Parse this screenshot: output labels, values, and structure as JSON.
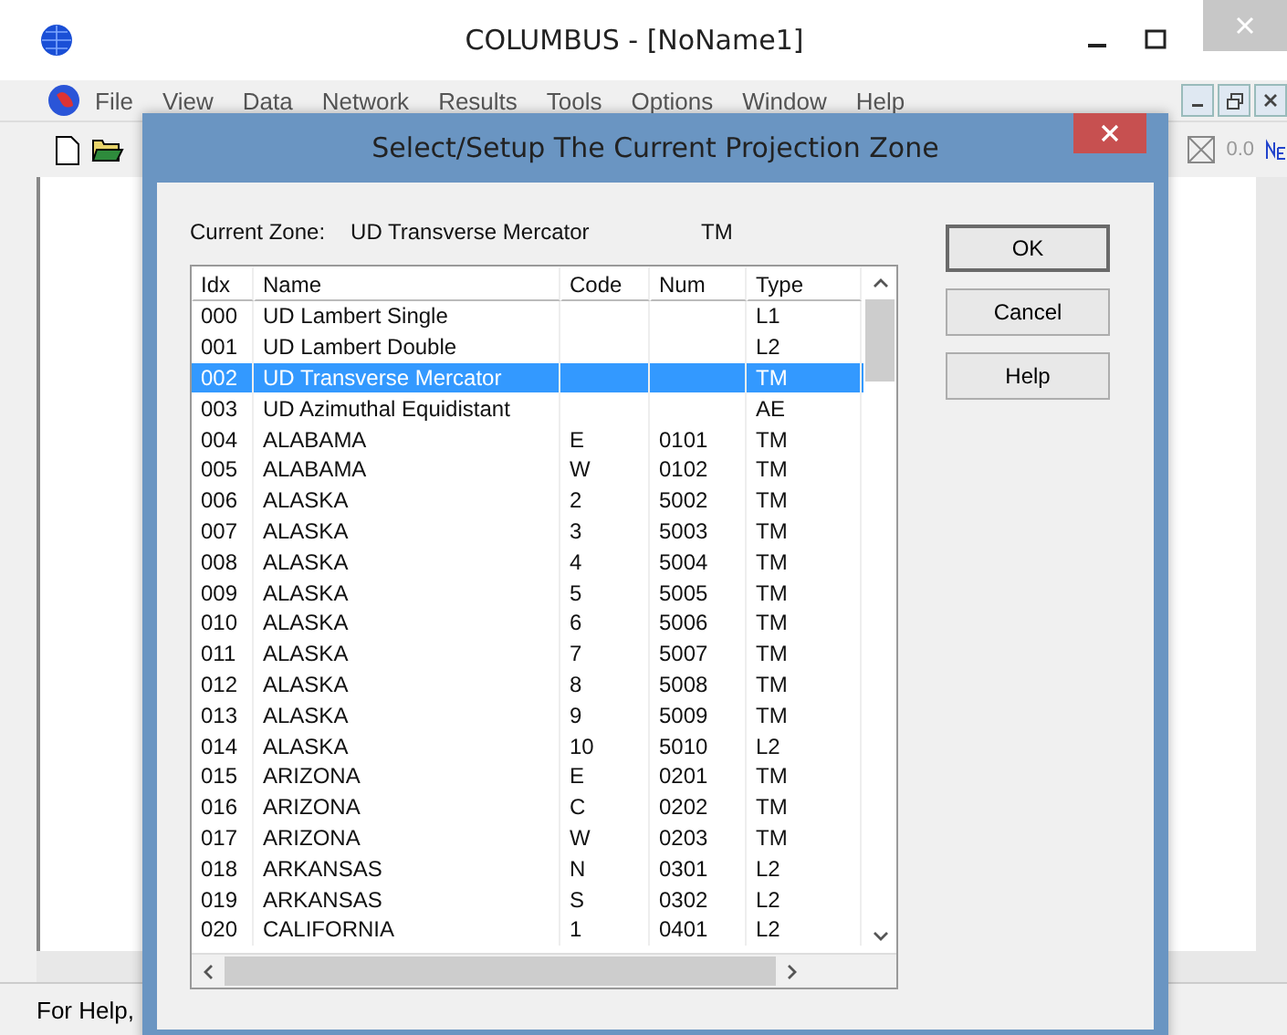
{
  "window": {
    "title": "COLUMBUS - [NoName1]"
  },
  "menu": [
    "File",
    "View",
    "Data",
    "Network",
    "Results",
    "Tools",
    "Options",
    "Window",
    "Help"
  ],
  "toolbar": {
    "readout": "0.0"
  },
  "status_bar": "For Help,",
  "dialog": {
    "title": "Select/Setup The Current Projection Zone",
    "current_zone": {
      "label": "Current Zone:",
      "name": "UD Transverse Mercator",
      "type": "TM"
    },
    "columns": [
      "Idx",
      "Name",
      "Code",
      "Num",
      "Type"
    ],
    "rows": [
      {
        "idx": "000",
        "name": "UD Lambert Single",
        "type": "L1",
        "selected": false
      },
      {
        "idx": "001",
        "name": "UD Lambert Double",
        "type": "L2",
        "selected": false
      },
      {
        "idx": "002",
        "name": "UD Transverse Mercator",
        "type": "TM",
        "selected": true
      },
      {
        "idx": "003",
        "name": "UD Azimuthal Equidistant",
        "type": "AE",
        "selected": false
      },
      {
        "idx": "004",
        "name": "ALABAMA",
        "code": "E",
        "num": "0101",
        "type": "TM",
        "selected": false
      },
      {
        "idx": "005",
        "name": "ALABAMA",
        "code": "W",
        "num": "0102",
        "type": "TM",
        "selected": false
      },
      {
        "idx": "006",
        "name": "ALASKA",
        "code": "2",
        "num": "5002",
        "type": "TM",
        "selected": false
      },
      {
        "idx": "007",
        "name": "ALASKA",
        "code": "3",
        "num": "5003",
        "type": "TM",
        "selected": false
      },
      {
        "idx": "008",
        "name": "ALASKA",
        "code": "4",
        "num": "5004",
        "type": "TM",
        "selected": false
      },
      {
        "idx": "009",
        "name": "ALASKA",
        "code": "5",
        "num": "5005",
        "type": "TM",
        "selected": false
      },
      {
        "idx": "010",
        "name": "ALASKA",
        "code": "6",
        "num": "5006",
        "type": "TM",
        "selected": false
      },
      {
        "idx": "011",
        "name": "ALASKA",
        "code": "7",
        "num": "5007",
        "type": "TM",
        "selected": false
      },
      {
        "idx": "012",
        "name": "ALASKA",
        "code": "8",
        "num": "5008",
        "type": "TM",
        "selected": false
      },
      {
        "idx": "013",
        "name": "ALASKA",
        "code": "9",
        "num": "5009",
        "type": "TM",
        "selected": false
      },
      {
        "idx": "014",
        "name": "ALASKA",
        "code": "10",
        "num": "5010",
        "type": "L2",
        "selected": false
      },
      {
        "idx": "015",
        "name": "ARIZONA",
        "code": "E",
        "num": "0201",
        "type": "TM",
        "selected": false
      },
      {
        "idx": "016",
        "name": "ARIZONA",
        "code": "C",
        "num": "0202",
        "type": "TM",
        "selected": false
      },
      {
        "idx": "017",
        "name": "ARIZONA",
        "code": "W",
        "num": "0203",
        "type": "TM",
        "selected": false
      },
      {
        "idx": "018",
        "name": "ARKANSAS",
        "code": "N",
        "num": "0301",
        "type": "L2",
        "selected": false
      },
      {
        "idx": "019",
        "name": "ARKANSAS",
        "code": "S",
        "num": "0302",
        "type": "L2",
        "selected": false
      },
      {
        "idx": "020",
        "name": "CALIFORNIA",
        "code": "1",
        "num": "0401",
        "type": "L2",
        "selected": false
      }
    ],
    "buttons": [
      "OK",
      "Cancel",
      "Help"
    ]
  }
}
